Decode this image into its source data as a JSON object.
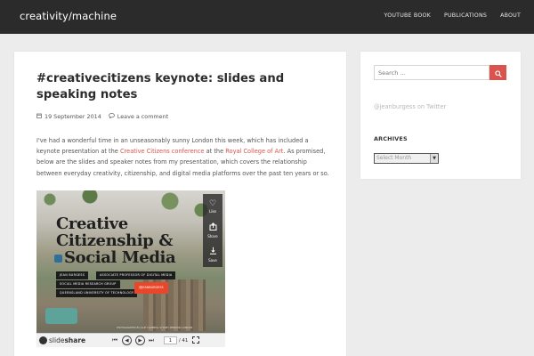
{
  "site": {
    "title": "creativity/machine"
  },
  "nav": [
    "YOUTUBE BOOK",
    "PUBLICATIONS",
    "ABOUT"
  ],
  "post": {
    "title": "#creativecitizens keynote: slides and speaking notes",
    "date": "19 September 2014",
    "comment_link": "Leave a comment",
    "excerpt": {
      "p1": "I've had a wonderful time in an unseasonably sunny London this week, which has included a keynote presentation at the ",
      "link1": "Creative Citizens conference",
      "p2": " at the ",
      "link2": "Royal College of Art",
      "p3": ". As promised, below are the slides and speaker notes from my presentation, which covers the relationship between everyday creativity, citizenship, and digital media platforms over the past ten years or so."
    }
  },
  "slide": {
    "line1": "Creative",
    "line2": "Citizenship &",
    "line3": "Social Media",
    "tags": [
      "JEAN BURGESS",
      "ASSOCIATE PROFESSOR OF DIGITAL MEDIA",
      "SOCIAL MEDIA RESEARCH GROUP",
      "QUEENSLAND UNIVERSITY OF TECHNOLOGY"
    ],
    "handle": "@JEANBURGESS",
    "credit": "PHOTOGRAPHED BY JULIE CAMPBELL SYDNEY MENDOZA LONDON",
    "share": {
      "like": "Like",
      "share": "Share",
      "save": "Save"
    },
    "player": {
      "logo_a": "slide",
      "logo_b": "share",
      "page": "1",
      "total": "/ 41"
    }
  },
  "sidebar": {
    "search_placeholder": "Search ...",
    "twitter": "@jeanburgess on Twitter",
    "archives_heading": "ARCHIVES",
    "archives_select": "Select Month"
  },
  "colors": {
    "accent": "#d9534f",
    "header": "#2b2b2b",
    "background": "#ececec",
    "slide_tag": "#e8472b"
  }
}
